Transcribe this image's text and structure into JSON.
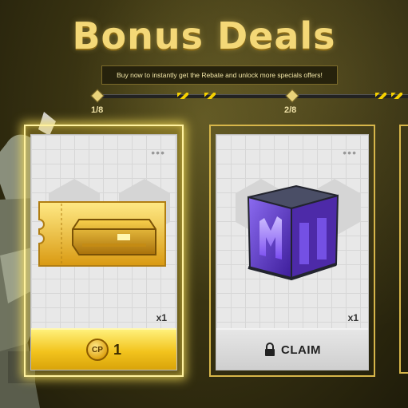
{
  "header": {
    "title": "Bonus Deals",
    "subtitle": "Buy now to instantly get the Rebate and unlock more specials offers!"
  },
  "progress": {
    "steps": [
      {
        "label": "1/8"
      },
      {
        "label": "2/8"
      }
    ]
  },
  "cards": [
    {
      "quantity": "x1",
      "price": "1",
      "currency_icon": "cp-coin-icon",
      "selected": true,
      "item_icon": "golden-crate-ticket-icon"
    },
    {
      "quantity": "x1",
      "action": "CLAIM",
      "action_icon": "lock-icon",
      "selected": false,
      "item_icon": "purple-crate-icon"
    }
  ],
  "colors": {
    "accent_gold": "#f2c31d",
    "title_gold": "#f4d877",
    "crate_purple": "#6a3fd6"
  }
}
